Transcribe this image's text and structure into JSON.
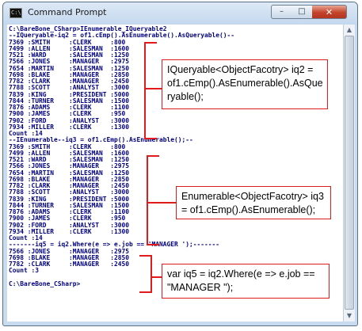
{
  "window": {
    "title": "Command Prompt",
    "icon": "C:\\",
    "controls": {
      "minimize": "–",
      "maximize": "□",
      "close": "✕"
    }
  },
  "console": {
    "text": "C:\\BareBone_CSharp>IEnumerable_IQueryable2\n--IQueryable-iq2 = of1.cEmp().AsEnumerable().AsQueryable()--\n7369 :SMITH     :CLERK     :800\n7499 :ALLEN     :SALESMAN  :1600\n7521 :WARD      :SALESMAN  :1250\n7566 :JONES     :MANAGER   :2975\n7654 :MARTIN    :SALESMAN  :1250\n7698 :BLAKE     :MANAGER   :2850\n7782 :CLARK     :MANAGER   :2450\n7788 :SCOTT     :ANALYST   :3000\n7839 :KING      :PRESIDENT :5000\n7844 :TURNER    :SALESMAN  :1500\n7876 :ADAMS     :CLERK     :1100\n7900 :JAMES     :CLERK     :950\n7902 :FORD      :ANALYST   :3000\n7934 :MILLER    :CLERK     :1300\nCount :14\n--IEnumerable--iq3 = of1.cEmp().AsEnumerable();--\n7369 :SMITH     :CLERK     :800\n7499 :ALLEN     :SALESMAN  :1600\n7521 :WARD      :SALESMAN  :1250\n7566 :JONES     :MANAGER   :2975\n7654 :MARTIN    :SALESMAN  :1250\n7698 :BLAKE     :MANAGER   :2850\n7782 :CLARK     :MANAGER   :2450\n7788 :SCOTT     :ANALYST   :3000\n7839 :KING      :PRESIDENT :5000\n7844 :TURNER    :SALESMAN  :1500\n7876 :ADAMS     :CLERK     :1100\n7900 :JAMES     :CLERK     :950\n7902 :FORD      :ANALYST   :3000\n7934 :MILLER    :CLERK     :1300\nCount :14\n-------iq5 = iq2.Where(e => e.job == 'MANAGER ');-------\n7566 :JONES     :MANAGER   :2975\n7698 :BLAKE     :MANAGER   :2850\n7782 :CLARK     :MANAGER   :2450\nCount :3\n\nC:\\BareBone_CSharp>"
  },
  "callouts": [
    {
      "text": "IQueryable<ObjectFacotry> iq2 =\nof1.cEmp().AsEnumerable().AsQue\nryable();"
    },
    {
      "text": "Enumerable<ObjectFacotry> iq3\n= of1.cEmp().AsEnumerable();"
    },
    {
      "text": "var iq5 = iq2.Where(e => e.job ==\n\"MANAGER \");"
    }
  ],
  "colors": {
    "console_text": "#000080",
    "annotation_red": "#e11b1b",
    "window_frame": "#c9dcef"
  }
}
